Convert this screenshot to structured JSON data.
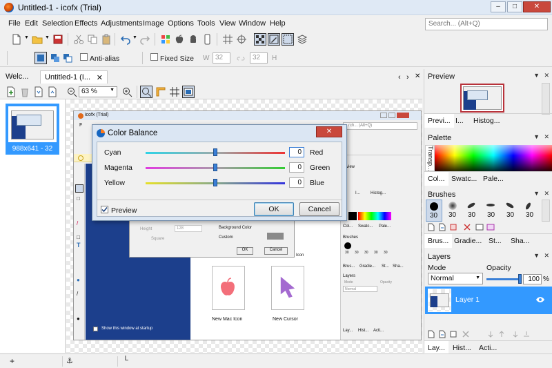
{
  "window": {
    "title": "Untitled-1 - icofx (Trial)"
  },
  "menu": [
    "File",
    "Edit",
    "Selection",
    "Effects",
    "Adjustments",
    "Image",
    "Options",
    "Tools",
    "View",
    "Window",
    "Help"
  ],
  "search": {
    "placeholder": "Search... (Alt+Q)"
  },
  "options_bar": {
    "anti_alias": "Anti-alias",
    "fixed_size": "Fixed Size",
    "w_label": "W",
    "w_value": "32",
    "h_label": "H",
    "h_value": "32"
  },
  "doc_tabs": [
    "Welc...",
    "Untitled-1 (I..."
  ],
  "zoom": {
    "value": "63 %"
  },
  "thumbnail": {
    "label": "988x641 - 32"
  },
  "right_panel": {
    "preview": {
      "title": "Preview",
      "tabs": [
        "Previ...",
        "I...",
        "Histog..."
      ]
    },
    "palette": {
      "title": "Palette",
      "side_label": "Transp...",
      "tabs": [
        "Col...",
        "Swatc...",
        "Pale..."
      ]
    },
    "brushes": {
      "title": "Brushes",
      "sizes": [
        "30",
        "30",
        "30",
        "30",
        "30",
        "30"
      ],
      "tabs": [
        "Brus...",
        "Gradie...",
        "St...",
        "Sha..."
      ]
    },
    "layers": {
      "title": "Layers",
      "mode_label": "Mode",
      "opacity_label": "Opacity",
      "mode_value": "Normal",
      "opacity_value": "100",
      "opacity_unit": "%",
      "opacity_fraction": 1.0,
      "layer_name": "Layer 1",
      "tabs": [
        "Lay...",
        "Hist...",
        "Acti..."
      ]
    }
  },
  "inner_screenshot": {
    "title": "icofx (Trial)",
    "search": "...rch... (Alt+Q)",
    "props": {
      "height_label": "Height",
      "height_value": "128",
      "square": "Square",
      "bg_color": "Background Color",
      "custom": "Custom",
      "ok": "OK",
      "cancel": "Cancel"
    },
    "startup": "Show this window at startup",
    "icons": [
      "New Mac Icon",
      "New Cursor"
    ],
    "panel": {
      "preview": "...view",
      "preview_tabs": [
        "I...",
        "Histog..."
      ],
      "palette_tabs": [
        "Col...",
        "Swatc...",
        "Pale..."
      ],
      "brushes": "Brushes",
      "brush_sizes": [
        "30",
        "30",
        "30",
        "30",
        "30"
      ],
      "brush_tabs": [
        "Brus...",
        "Gradie...",
        "St...",
        "Sha..."
      ],
      "layers": "Layers",
      "mode": "Mode",
      "mode_value": "Normal",
      "opacity": "Opacity",
      "layer_tabs": [
        "Lay...",
        "Hist...",
        "Acti..."
      ]
    }
  },
  "dialog": {
    "title": "Color Balance",
    "sliders": [
      {
        "left": "Cyan",
        "right": "Red",
        "value": "0"
      },
      {
        "left": "Magenta",
        "right": "Green",
        "value": "0"
      },
      {
        "left": "Yellow",
        "right": "Blue",
        "value": "0"
      }
    ],
    "preview": "Preview",
    "ok": "OK",
    "cancel": "Cancel"
  },
  "colors": {
    "accent": "#3399ff",
    "inner_blue": "#1c3f8c"
  }
}
